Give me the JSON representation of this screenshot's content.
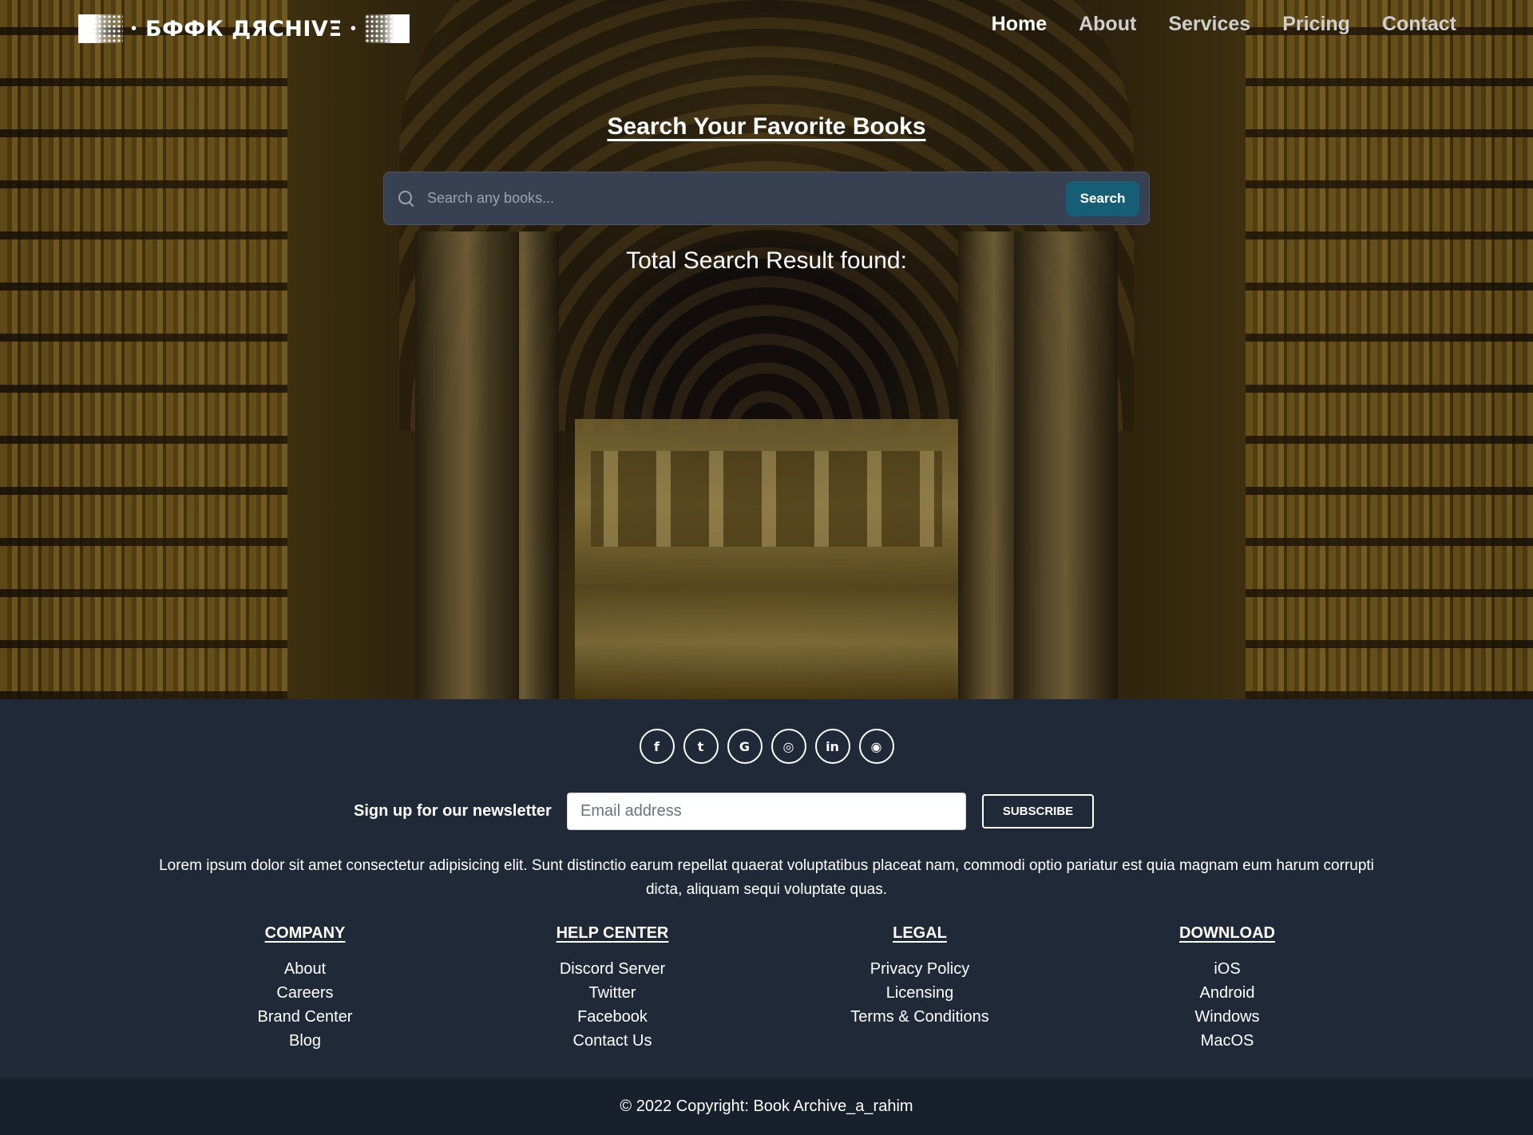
{
  "nav": {
    "logo_text": "БФФК ДЯCHIVΞ",
    "links": [
      "Home",
      "About",
      "Services",
      "Pricing",
      "Contact"
    ]
  },
  "hero": {
    "title": "Search Your Favorite Books",
    "search_placeholder": "Search any books...",
    "search_button": "Search",
    "result_label": "Total Search Result found:"
  },
  "footer": {
    "socials": [
      {
        "icon": "facebook-icon",
        "glyph": "f"
      },
      {
        "icon": "twitter-icon",
        "glyph": "t"
      },
      {
        "icon": "google-icon",
        "glyph": "G"
      },
      {
        "icon": "instagram-icon",
        "glyph": "◎"
      },
      {
        "icon": "linkedin-icon",
        "glyph": "in"
      },
      {
        "icon": "github-icon",
        "glyph": "◉"
      }
    ],
    "newsletter_label": "Sign up for our newsletter",
    "email_placeholder": "Email address",
    "subscribe_button": "SUBSCRIBE",
    "lorem": "Lorem ipsum dolor sit amet consectetur adipisicing elit. Sunt distinctio earum repellat quaerat voluptatibus placeat nam, commodi optio pariatur est quia magnam eum harum corrupti dicta, aliquam sequi voluptate quas.",
    "columns": [
      {
        "title": "COMPANY",
        "items": [
          "About",
          "Careers",
          "Brand Center",
          "Blog"
        ]
      },
      {
        "title": "HELP CENTER",
        "items": [
          "Discord Server",
          "Twitter",
          "Facebook",
          "Contact Us"
        ]
      },
      {
        "title": "LEGAL",
        "items": [
          "Privacy Policy",
          "Licensing",
          "Terms & Conditions"
        ]
      },
      {
        "title": "DOWNLOAD",
        "items": [
          "iOS",
          "Android",
          "Windows",
          "MacOS"
        ]
      }
    ],
    "copyright": "© 2022 Copyright: Book Archive_a_rahim"
  },
  "colors": {
    "footer_bg": "#1f2937",
    "copyright_bg": "#18202b",
    "search_button": "#155e75",
    "search_bar": "#374151"
  }
}
